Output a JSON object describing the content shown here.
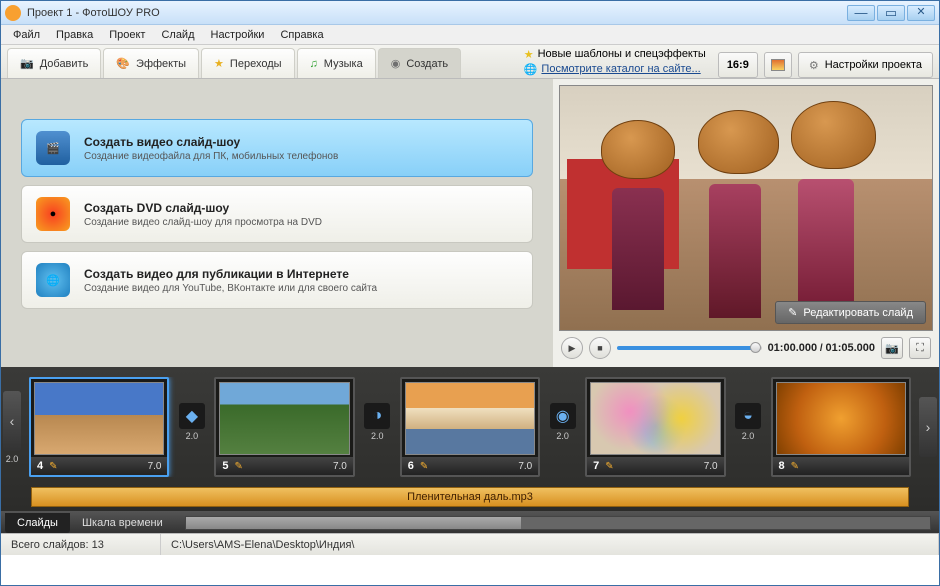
{
  "window": {
    "title": "Проект 1 - ФотоШОУ PRO"
  },
  "menu": [
    "Файл",
    "Правка",
    "Проект",
    "Слайд",
    "Настройки",
    "Справка"
  ],
  "tabs": {
    "add": "Добавить",
    "effects": "Эффекты",
    "transitions": "Переходы",
    "music": "Музыка",
    "create": "Создать"
  },
  "promo": {
    "line1": "Новые шаблоны и спецэффекты",
    "line2": "Посмотрите каталог на сайте..."
  },
  "aspect": "16:9",
  "project_settings": "Настройки проекта",
  "create_options": [
    {
      "title": "Создать видео слайд-шоу",
      "desc": "Создание видеофайла для ПК, мобильных телефонов"
    },
    {
      "title": "Создать DVD слайд-шоу",
      "desc": "Создание видео слайд-шоу для просмотра на DVD"
    },
    {
      "title": "Создать видео для публикации в Интернете",
      "desc": "Создание видео для YouTube, ВКонтакте или для своего сайта"
    }
  ],
  "preview": {
    "edit_btn": "Редактировать слайд"
  },
  "playback": {
    "current": "01:00.000",
    "total": "01:05.000"
  },
  "nav_left_val": "2.0",
  "slides": [
    {
      "n": "4",
      "dur": "7.0",
      "tdur": "2.0",
      "thumb": "thumb-camels",
      "selected": true
    },
    {
      "n": "5",
      "dur": "7.0",
      "tdur": "2.0",
      "thumb": "thumb-jungle",
      "selected": false
    },
    {
      "n": "6",
      "dur": "7.0",
      "tdur": "2.0",
      "thumb": "thumb-taj",
      "selected": false
    },
    {
      "n": "7",
      "dur": "7.0",
      "tdur": "2.0",
      "thumb": "thumb-holi",
      "selected": false
    },
    {
      "n": "8",
      "dur": "",
      "tdur": "",
      "thumb": "thumb-hands",
      "selected": false
    }
  ],
  "audio_track": "Пленительная даль.mp3",
  "bottom_tabs": {
    "slides": "Слайды",
    "timeline": "Шкала времени"
  },
  "status": {
    "count_label": "Всего слайдов:",
    "count": "13",
    "path": "C:\\Users\\AMS-Elena\\Desktop\\Индия\\"
  }
}
